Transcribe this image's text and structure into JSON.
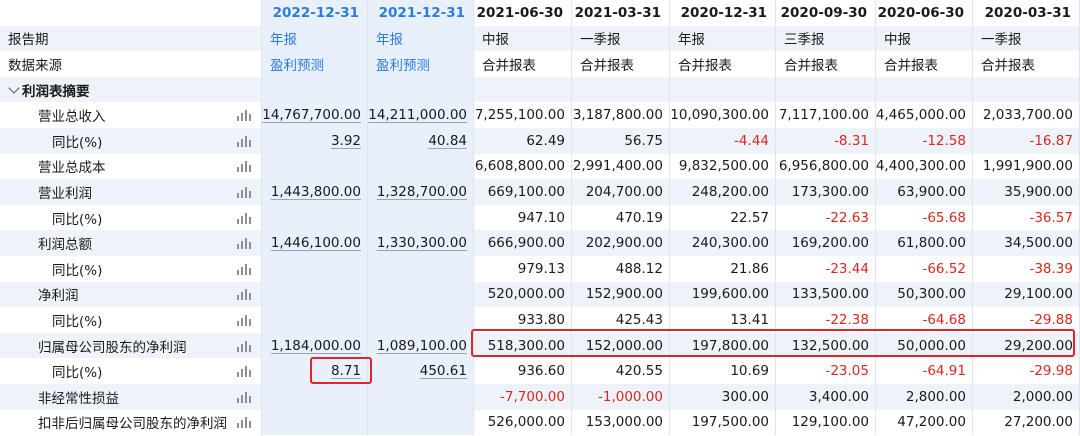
{
  "columns": [
    "2022-12-31",
    "2021-12-31",
    "2021-06-30",
    "2021-03-31",
    "2020-12-31",
    "2020-09-30",
    "2020-06-30",
    "2020-03-31"
  ],
  "report_period": {
    "label": "报告期",
    "values": [
      "年报",
      "年报",
      "中报",
      "一季报",
      "年报",
      "三季报",
      "中报",
      "一季报"
    ]
  },
  "data_source": {
    "label": "数据来源",
    "values": [
      "盈利预测",
      "盈利预测",
      "合并报表",
      "合并报表",
      "合并报表",
      "合并报表",
      "合并报表",
      "合并报表"
    ]
  },
  "section": {
    "label": "利润表摘要"
  },
  "rows": [
    {
      "label": "营业总收入",
      "indent": 1,
      "chart": true,
      "values": [
        "14,767,700.00",
        "14,211,000.00",
        "7,255,100.00",
        "3,187,800.00",
        "10,090,300.00",
        "7,117,100.00",
        "4,465,000.00",
        "2,033,700.00"
      ]
    },
    {
      "label": "同比(%)",
      "indent": 2,
      "chart": true,
      "values": [
        "3.92",
        "40.84",
        "62.49",
        "56.75",
        "-4.44",
        "-8.31",
        "-12.58",
        "-16.87"
      ]
    },
    {
      "label": "营业总成本",
      "indent": 1,
      "chart": true,
      "values": [
        "",
        "",
        "6,608,800.00",
        "2,991,400.00",
        "9,832,500.00",
        "6,956,800.00",
        "4,400,300.00",
        "1,991,900.00"
      ]
    },
    {
      "label": "营业利润",
      "indent": 1,
      "chart": true,
      "values": [
        "1,443,800.00",
        "1,328,700.00",
        "669,100.00",
        "204,700.00",
        "248,200.00",
        "173,300.00",
        "63,900.00",
        "35,900.00"
      ]
    },
    {
      "label": "同比(%)",
      "indent": 2,
      "chart": true,
      "values": [
        "",
        "",
        "947.10",
        "470.19",
        "22.57",
        "-22.63",
        "-65.68",
        "-36.57"
      ]
    },
    {
      "label": "利润总额",
      "indent": 1,
      "chart": true,
      "values": [
        "1,446,100.00",
        "1,330,300.00",
        "666,900.00",
        "202,900.00",
        "240,300.00",
        "169,200.00",
        "61,800.00",
        "34,500.00"
      ]
    },
    {
      "label": "同比(%)",
      "indent": 2,
      "chart": true,
      "values": [
        "",
        "",
        "979.13",
        "488.12",
        "21.86",
        "-23.44",
        "-66.52",
        "-38.39"
      ]
    },
    {
      "label": "净利润",
      "indent": 1,
      "chart": true,
      "values": [
        "",
        "",
        "520,000.00",
        "152,900.00",
        "199,600.00",
        "133,500.00",
        "50,300.00",
        "29,100.00"
      ]
    },
    {
      "label": "同比(%)",
      "indent": 2,
      "chart": true,
      "values": [
        "",
        "",
        "933.80",
        "425.43",
        "13.41",
        "-22.38",
        "-64.68",
        "-29.88"
      ]
    },
    {
      "label": "归属母公司股东的净利润",
      "indent": 1,
      "chart": true,
      "values": [
        "1,184,000.00",
        "1,089,100.00",
        "518,300.00",
        "152,000.00",
        "197,800.00",
        "132,500.00",
        "50,000.00",
        "29,200.00"
      ]
    },
    {
      "label": "同比(%)",
      "indent": 2,
      "chart": true,
      "values": [
        "8.71",
        "450.61",
        "936.60",
        "420.55",
        "10.69",
        "-23.05",
        "-64.91",
        "-29.98"
      ]
    },
    {
      "label": "非经常性损益",
      "indent": 1,
      "chart": true,
      "values": [
        "",
        "",
        "-7,700.00",
        "-1,000.00",
        "300.00",
        "3,400.00",
        "2,800.00",
        "2,000.00"
      ]
    },
    {
      "label": "扣非后归属母公司股东的净利润",
      "indent": 1,
      "chart": true,
      "values": [
        "",
        "",
        "526,000.00",
        "153,000.00",
        "197,500.00",
        "129,100.00",
        "47,200.00",
        "27,200.00"
      ]
    }
  ],
  "icons": {
    "chart": "bar-chart-icon",
    "collapse": "chevron-down-icon"
  },
  "colors": {
    "accent": "#2c7be5",
    "negative": "#d9281f",
    "highlight": "#e0262b",
    "row_shade": "#eef3f9"
  }
}
